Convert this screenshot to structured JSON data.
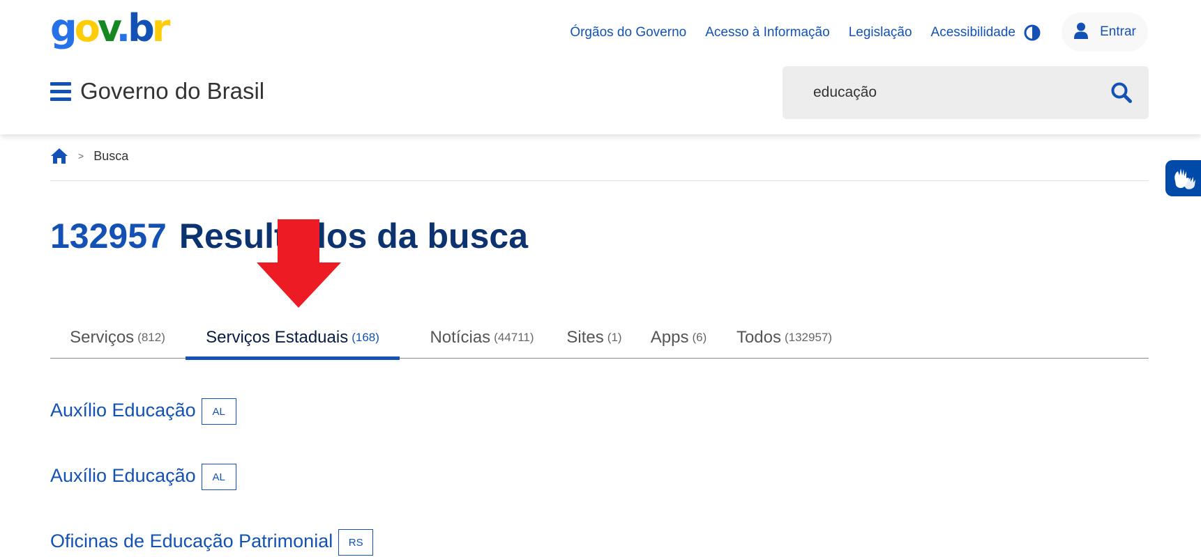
{
  "header": {
    "logo": {
      "g": "g",
      "o": "o",
      "v": "v",
      "dot": ".",
      "b": "b",
      "r": "r"
    },
    "top_links": [
      "Órgãos do Governo",
      "Acesso à Informação",
      "Legislação",
      "Acessibilidade"
    ],
    "contrast_icon": "contrast-icon",
    "login_label": "Entrar",
    "login_icon": "user-icon",
    "site_title": "Governo do Brasil",
    "menu_icon": "hamburger-icon",
    "search": {
      "value": "educação",
      "icon": "search-icon"
    }
  },
  "breadcrumb": {
    "home_icon": "home-icon",
    "separator": ">",
    "current": "Busca"
  },
  "heading": {
    "count": "132957",
    "label": "Resultados da busca"
  },
  "tabs": [
    {
      "label": "Serviços",
      "count": "(812)"
    },
    {
      "label": "Serviços Estaduais",
      "count": "(168)",
      "active": true
    },
    {
      "label": "Notícias",
      "count": "(44711)"
    },
    {
      "label": "Sites",
      "count": "(1)"
    },
    {
      "label": "Apps",
      "count": "(6)"
    },
    {
      "label": "Todos",
      "count": "(132957)"
    }
  ],
  "results": [
    {
      "title": "Auxílio Educação",
      "state": "AL"
    },
    {
      "title": "Auxílio Educação",
      "state": "AL"
    },
    {
      "title": "Oficinas de Educação Patrimonial",
      "state": "RS"
    }
  ],
  "vlibras_icon": "sign-language-hands-icon",
  "annotation_icon": "red-down-arrow-icon",
  "colors": {
    "primary": "#1351b4",
    "heading": "#0c326f",
    "annotation": "#ed1c24",
    "vlibras": "#004aa9"
  }
}
